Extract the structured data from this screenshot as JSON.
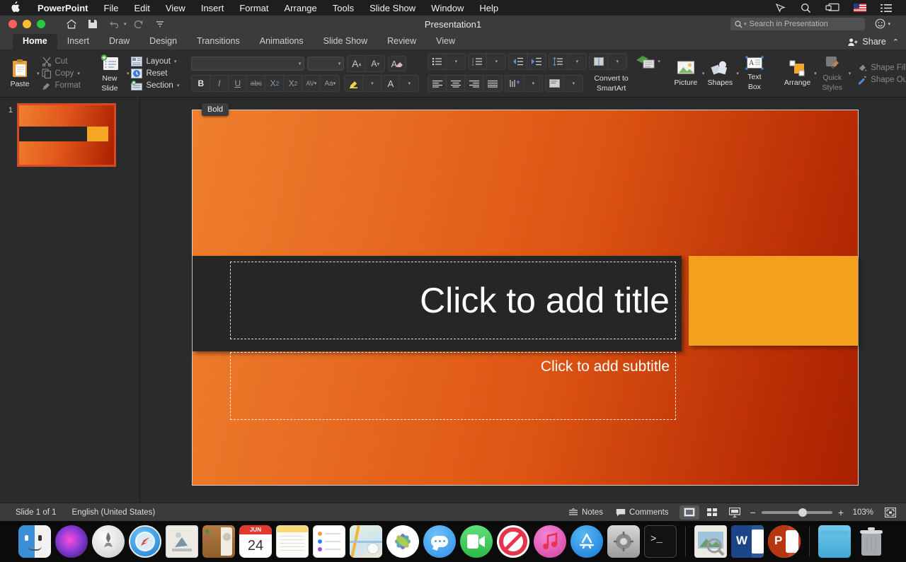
{
  "macbar": {
    "apple_icon": "apple-icon",
    "items": [
      {
        "label": "PowerPoint",
        "bold": true
      },
      {
        "label": "File",
        "bold": false
      },
      {
        "label": "Edit",
        "bold": false
      },
      {
        "label": "View",
        "bold": false
      },
      {
        "label": "Insert",
        "bold": false
      },
      {
        "label": "Format",
        "bold": false
      },
      {
        "label": "Arrange",
        "bold": false
      },
      {
        "label": "Tools",
        "bold": false
      },
      {
        "label": "Slide Show",
        "bold": false
      },
      {
        "label": "Window",
        "bold": false
      },
      {
        "label": "Help",
        "bold": false
      }
    ],
    "status_icons": [
      "pen-icon",
      "spotlight-search-icon",
      "screen-mirroring-icon",
      "us-flag-icon",
      "control-center-icon"
    ]
  },
  "titlebar": {
    "document_title": "Presentation1",
    "traffic_lights": [
      "close-red",
      "minimize-yellow",
      "zoom-green"
    ],
    "quick_access": [
      {
        "name": "home-icon",
        "label": "Home"
      },
      {
        "name": "save-icon",
        "label": "Save"
      },
      {
        "name": "undo-icon",
        "label": "Undo"
      },
      {
        "name": "redo-icon",
        "label": "Redo"
      },
      {
        "name": "customize-toolbar-icon",
        "label": "Customize"
      }
    ],
    "search_placeholder": "Search in Presentation",
    "share_label": "Share",
    "collapse_ribbon_label": "^"
  },
  "tabs": [
    {
      "label": "Home",
      "active": true
    },
    {
      "label": "Insert",
      "active": false
    },
    {
      "label": "Draw",
      "active": false
    },
    {
      "label": "Design",
      "active": false
    },
    {
      "label": "Transitions",
      "active": false
    },
    {
      "label": "Animations",
      "active": false
    },
    {
      "label": "Slide Show",
      "active": false
    },
    {
      "label": "Review",
      "active": false
    },
    {
      "label": "View",
      "active": false
    }
  ],
  "ribbon": {
    "paste_label": "Paste",
    "cut_label": "Cut",
    "copy_label": "Copy",
    "format_label": "Format",
    "new_slide_label_1": "New",
    "new_slide_label_2": "Slide",
    "layout_label": "Layout",
    "reset_label": "Reset",
    "section_label": "Section",
    "font_name_value": "",
    "font_size_value": "",
    "grow_font_label": "A",
    "shrink_font_label": "A",
    "clear_format_label": "A",
    "bold_label": "B",
    "italic_label": "I",
    "underline_label": "U",
    "strike_label": "abc",
    "superscript_label": "X",
    "subscript_label": "X",
    "char_spacing_label": "AV",
    "change_case_label": "Aa",
    "highlight_label": "highlight-icon",
    "font_color_label": "A",
    "convert_smartart_1": "Convert to",
    "convert_smartart_2": "SmartArt",
    "picture_label": "Picture",
    "shapes_label": "Shapes",
    "textbox_label_1": "Text",
    "textbox_label_2": "Box",
    "arrange_label": "Arrange",
    "quickstyles_label_1": "Quick",
    "quickstyles_label_2": "Styles",
    "shape_fill_label": "Shape Fill",
    "shape_outline_label": "Shape Outline"
  },
  "tooltip": {
    "text": "Bold"
  },
  "thumbnails": [
    {
      "number": "1",
      "selected": true
    }
  ],
  "slide": {
    "title_placeholder": "Click to add title",
    "subtitle_placeholder": "Click to add subtitle",
    "colors": {
      "gradient_start": "#ef7f2e",
      "gradient_end": "#a82000",
      "title_band": "#262626",
      "accent_block": "#f3a01f"
    }
  },
  "statusbar": {
    "slide_count": "Slide 1 of 1",
    "language": "English (United States)",
    "notes_label": "Notes",
    "comments_label": "Comments",
    "views": [
      {
        "name": "normal-view",
        "active": true
      },
      {
        "name": "slide-sorter-view",
        "active": false
      },
      {
        "name": "slideshow-view",
        "active": false
      }
    ],
    "zoom_out_label": "−",
    "zoom_in_label": "+",
    "zoom_level": "103%",
    "fit_slide_label": "fit-to-window-icon"
  },
  "dock": {
    "items": [
      {
        "name": "finder",
        "running": true
      },
      {
        "name": "siri",
        "running": false
      },
      {
        "name": "launchpad",
        "running": false
      },
      {
        "name": "safari",
        "running": false
      },
      {
        "name": "mail",
        "running": false
      },
      {
        "name": "contacts",
        "running": false
      },
      {
        "name": "calendar",
        "running": false,
        "month": "JUN",
        "day": "24"
      },
      {
        "name": "notes",
        "running": false
      },
      {
        "name": "reminders",
        "running": false
      },
      {
        "name": "maps",
        "running": false
      },
      {
        "name": "photos",
        "running": false
      },
      {
        "name": "messages",
        "running": false
      },
      {
        "name": "facetime",
        "running": false
      },
      {
        "name": "do-not-disturb",
        "running": false
      },
      {
        "name": "itunes",
        "running": false
      },
      {
        "name": "app-store",
        "running": false
      },
      {
        "name": "system-preferences",
        "running": false
      },
      {
        "name": "terminal",
        "running": false
      },
      {
        "name": "preview",
        "running": false
      },
      {
        "name": "word",
        "running": true
      },
      {
        "name": "powerpoint",
        "running": true
      },
      {
        "name": "downloads-folder",
        "running": false
      },
      {
        "name": "trash",
        "running": false
      }
    ]
  }
}
